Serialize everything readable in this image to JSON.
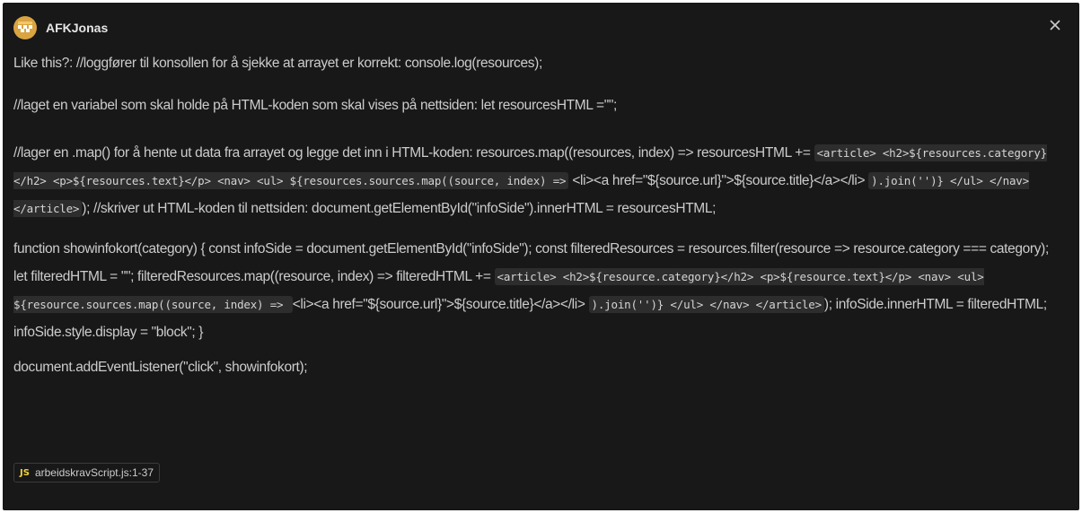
{
  "message": {
    "author": "AFKJonas",
    "paragraphs": [
      {
        "runs": [
          {
            "t": "text",
            "v": "Like this?: //loggfører til konsollen for å sjekke at arrayet er korrekt: console.log(resources);"
          }
        ]
      },
      {
        "runs": [
          {
            "t": "text",
            "v": "//laget en variabel som skal holde på HTML-koden som skal vises på nettsiden: let resourcesHTML =\"\";"
          }
        ]
      },
      {
        "runs": [
          {
            "t": "text",
            "v": "//lager en .map() for å hente ut data fra arrayet og legge det inn i HTML-koden: resources.map((resources, index) => resourcesHTML += "
          },
          {
            "t": "code",
            "v": "<article> <h2>${resources.category}</h2> <p>${resources.text}</p> <nav> <ul> ${resources.sources.map((source, index) =>"
          },
          {
            "t": "text",
            "v": " <li><a href=\"${source.url}\">${source.title}</a></li> "
          },
          {
            "t": "code",
            "v": ").join('')} </ul> </nav> </article>"
          },
          {
            "t": "text",
            "v": "); //skriver ut HTML-koden til nettsiden: document.getElementById(\"infoSide\").innerHTML = resourcesHTML;"
          }
        ]
      },
      {
        "runs": [
          {
            "t": "text",
            "v": "function showinfokort(category) { const infoSide = document.getElementById(\"infoSide\"); const filteredResources = resources.filter(resource => resource.category === category); let filteredHTML = \"\"; filteredResources.map((resource, index) => filteredHTML += "
          },
          {
            "t": "code",
            "v": "<article> <h2>${resource.category}</h2> <p>${resource.text}</p> <nav> <ul> ${resource.sources.map((source, index) => "
          },
          {
            "t": "text",
            "v": " <li><a href=\"${source.url}\">${source.title}</a></li> "
          },
          {
            "t": "code",
            "v": ").join('')} </ul> </nav> </article>"
          },
          {
            "t": "text",
            "v": "); infoSide.innerHTML = filteredHTML; infoSide.style.display = \"block\"; }"
          }
        ]
      },
      {
        "runs": [
          {
            "t": "text",
            "v": "document.addEventListener(\"click\", showinfokort);"
          }
        ]
      }
    ],
    "file_reference": {
      "icon_label": "JS",
      "filename": "arbeidskravScript.js",
      "range": ":1-37"
    }
  },
  "colors": {
    "background": "#181818",
    "text": "#cccccc",
    "code_bg": "#2d2d2d",
    "js_icon": "#f1d240"
  },
  "icons": {
    "avatar": "avatar-icon",
    "close": "close-icon",
    "file": "javascript-file-icon"
  }
}
